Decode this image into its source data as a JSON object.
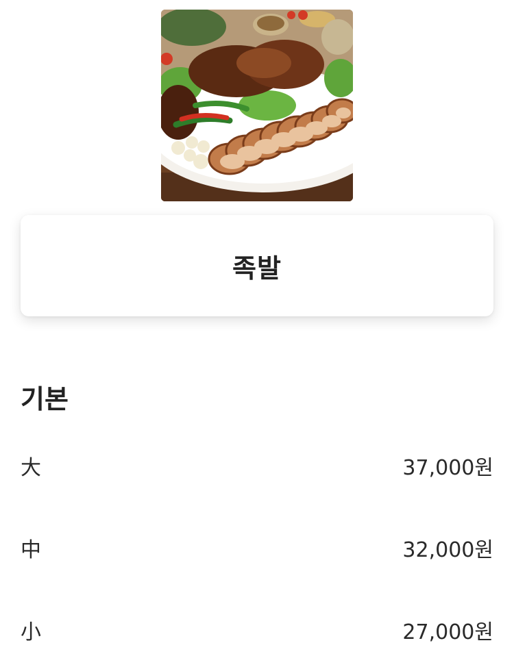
{
  "menu_item": {
    "title": "족발",
    "image_alt": "족발 사진"
  },
  "section": {
    "title": "기본"
  },
  "options": [
    {
      "size": "大",
      "price": "37,000원"
    },
    {
      "size": "中",
      "price": "32,000원"
    },
    {
      "size": "小",
      "price": "27,000원"
    }
  ]
}
